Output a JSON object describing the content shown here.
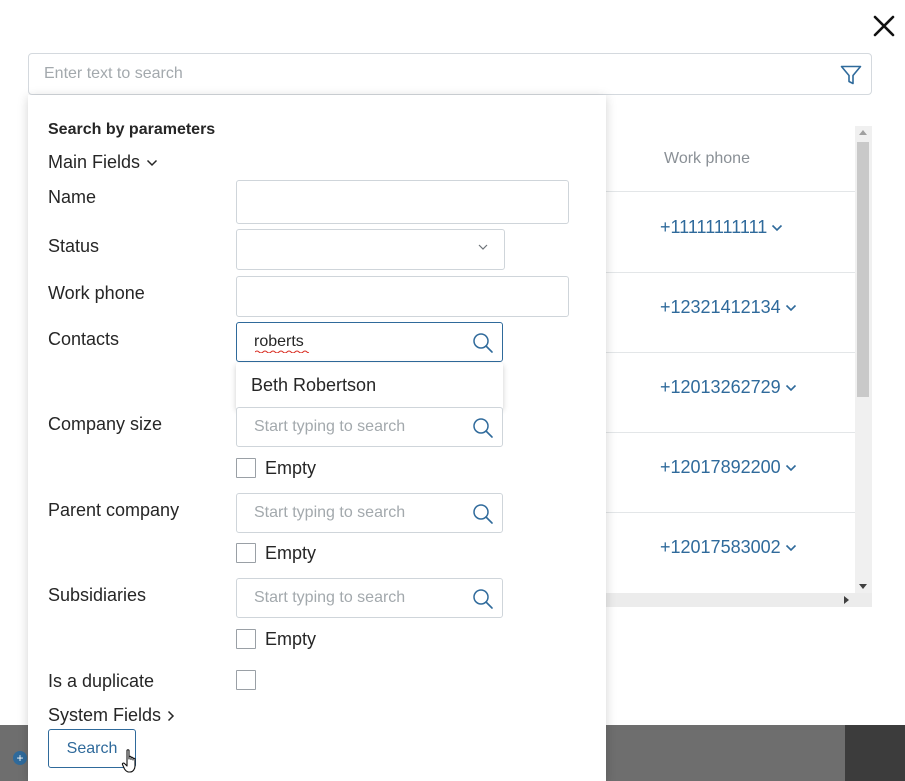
{
  "search": {
    "placeholder": "Enter text to search",
    "value": ""
  },
  "icons": {
    "close": "close-icon",
    "filter": "filter-icon",
    "search": "search-icon",
    "chevron": "chevron-down-icon",
    "chevron_right": "chevron-right-icon"
  },
  "colors": {
    "accent": "#2f6a9b",
    "text": "#262626",
    "placeholder": "#a3a9ad",
    "border": "#cfd5da"
  },
  "table": {
    "column_header": "Work phone",
    "rows": [
      {
        "phone": "+11111111111"
      },
      {
        "phone": "+12321412134"
      },
      {
        "phone": "+12013262729"
      },
      {
        "phone": "+12017892200"
      },
      {
        "phone": "+12017583002"
      }
    ]
  },
  "filter_panel": {
    "title": "Search by parameters",
    "main_fields_label": "Main Fields",
    "system_fields_label": "System Fields",
    "fields": {
      "name": {
        "label": "Name",
        "value": ""
      },
      "status": {
        "label": "Status",
        "value": ""
      },
      "work_phone": {
        "label": "Work phone",
        "value": ""
      },
      "contacts": {
        "label": "Contacts",
        "value": "roberts",
        "suggestion": "Beth Robertson"
      },
      "company_size": {
        "label": "Company size",
        "placeholder": "Start typing to search",
        "empty_label": "Empty"
      },
      "parent_company": {
        "label": "Parent company",
        "placeholder": "Start typing to search",
        "empty_label": "Empty"
      },
      "subsidiaries": {
        "label": "Subsidiaries",
        "placeholder": "Start typing to search",
        "empty_label": "Empty"
      },
      "is_duplicate": {
        "label": "Is a duplicate",
        "checked": false
      }
    },
    "search_button": "Search"
  }
}
